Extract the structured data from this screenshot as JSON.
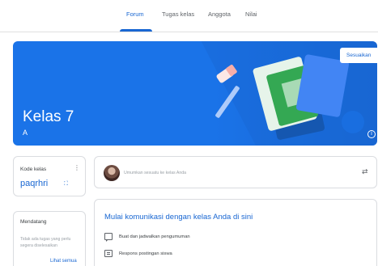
{
  "nav": {
    "tabs": [
      {
        "label": "Forum",
        "active": true
      },
      {
        "label": "Tugas kelas",
        "active": false
      },
      {
        "label": "Anggota",
        "active": false
      },
      {
        "label": "Nilai",
        "active": false
      }
    ]
  },
  "banner": {
    "title": "Kelas 7",
    "section": "A",
    "customize_label": "Sesuaikan",
    "info_glyph": "i",
    "colors": {
      "background": "#1a73e8",
      "accent": "#1967d2"
    }
  },
  "class_code": {
    "label": "Kode kelas",
    "value": "paqrhri",
    "menu_glyph": "⋮",
    "fullscreen_glyph": "⛶"
  },
  "upcoming": {
    "title": "Mendatang",
    "empty_text": "Tidak ada tugas yang perlu segera diselesaikan",
    "view_all_label": "Lihat semua"
  },
  "announce": {
    "placeholder": "Umumkan sesuatu ke kelas Anda",
    "repost_glyph": "⇄"
  },
  "communicate": {
    "title": "Mulai komunikasi dengan kelas Anda di sini",
    "items": [
      {
        "label": "Buat dan jadwalkan pengumuman",
        "icon": "chat-icon"
      },
      {
        "label": "Respons postingan siswa",
        "icon": "list-icon"
      }
    ]
  }
}
